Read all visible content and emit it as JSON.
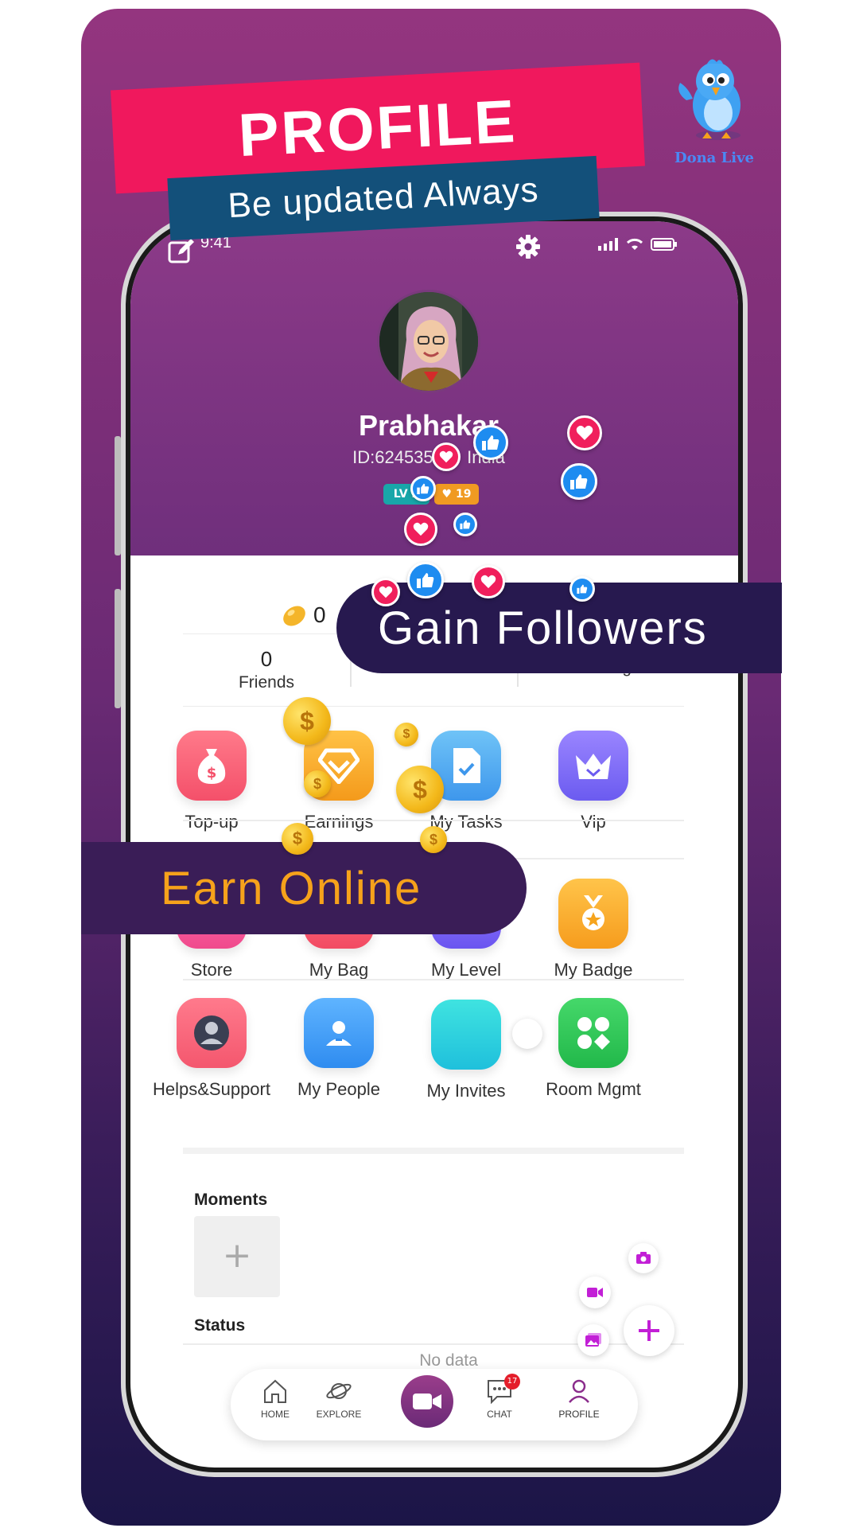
{
  "banner": {
    "title": "PROFILE",
    "subtitle": "Be updated Always"
  },
  "logo": {
    "text": "Dona Live"
  },
  "statusbar": {
    "time": "9:41"
  },
  "profile": {
    "name": "Prabhakar",
    "id_text": "ID:6245350",
    "country": "India",
    "level": "LV 2",
    "hearts": "19"
  },
  "beans": {
    "count": "0"
  },
  "stats": [
    {
      "value": "0",
      "label": "Friends"
    },
    {
      "value": "",
      "label": "Followers"
    },
    {
      "value": "",
      "label": "Followings"
    }
  ],
  "grid": {
    "row1": [
      "Top-up",
      "Earnings",
      "My Tasks",
      "Vip"
    ],
    "row2": [
      "Store",
      "My Bag",
      "My Level",
      "My Badge"
    ],
    "row3": [
      "Helps&Support",
      "My People",
      "My Invites",
      "Room Mgmt"
    ]
  },
  "moments": {
    "title": "Moments",
    "add": "+"
  },
  "status": {
    "title": "Status",
    "empty": "No data"
  },
  "nav": {
    "home": "HOME",
    "explore": "EXPLORE",
    "chat": "CHAT",
    "chat_badge": "17",
    "profile": "PROFILE"
  },
  "overlays": {
    "gain_followers": "Gain Followers",
    "earn_online": "Earn Online"
  },
  "coin_symbol": "$",
  "colors": {
    "card_gradient_top": "#94357f",
    "card_gradient_bottom": "#1b1547",
    "banner_red": "#f0185d",
    "banner_blue": "#13507a",
    "accent_orange": "#f6a21b",
    "heart": "#f01f5c",
    "like": "#1e8cf0"
  },
  "icons": {
    "edit": "edit-icon",
    "settings": "gear-icon",
    "topup": "money-bag-icon",
    "earnings": "diamond-icon",
    "tasks": "document-check-icon",
    "vip": "crown-icon",
    "store": "shop-icon",
    "bag": "bag-icon",
    "level": "star-icon",
    "badge": "medal-icon",
    "support": "user-icon",
    "people": "people-icon",
    "invites": "invite-icon",
    "room": "apps-icon",
    "camera": "camera-icon",
    "video": "video-icon",
    "gallery": "gallery-icon",
    "add": "plus-icon"
  }
}
